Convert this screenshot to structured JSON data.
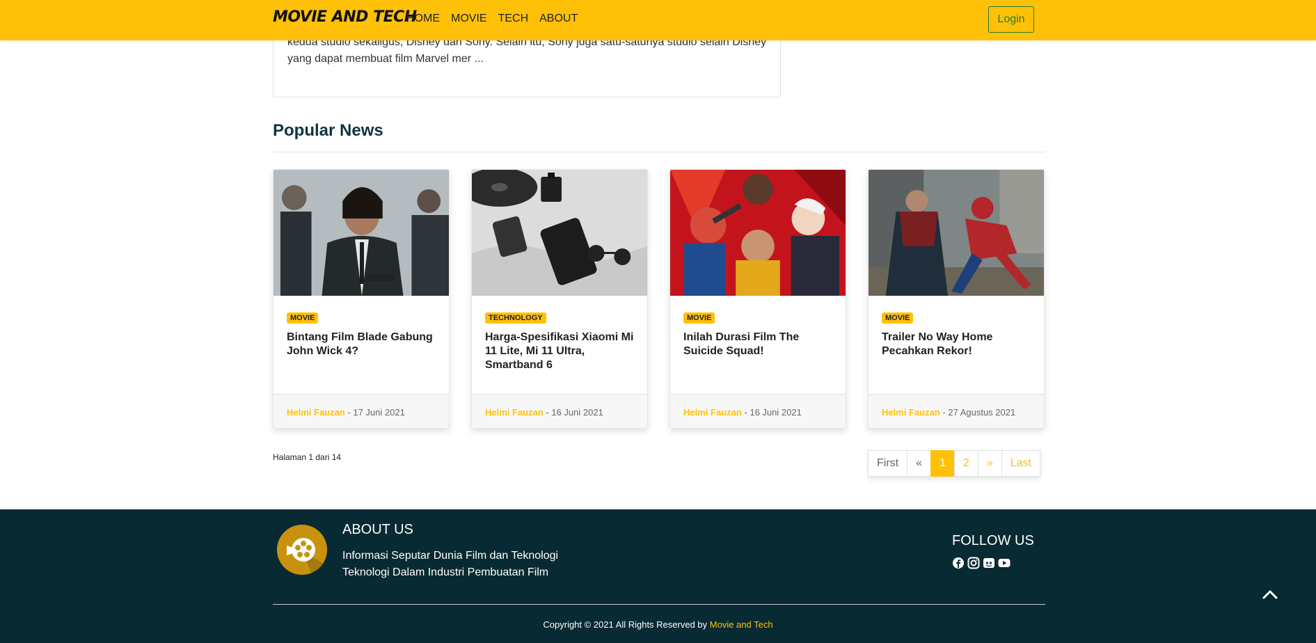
{
  "navbar": {
    "brand": "MOVIE AND TECH",
    "links": [
      "HOME",
      "MOVIE",
      "TECH",
      "ABOUT"
    ],
    "login_label": "Login",
    "bg_color": "#ffc107"
  },
  "previous_article": {
    "excerpt": "kedua studio sekaligus, Disney dan Sony. Selain itu, Sony juga satu-satunya studio selain Disney yang dapat membuat film Marvel mer ..."
  },
  "popular": {
    "heading": "Popular News",
    "cards": [
      {
        "image": "john-wick-photo",
        "category": "MOVIE",
        "title": "Bintang Film Blade Gabung John Wick 4?",
        "author": "Helmi Fauzan",
        "date": " - 17 Juni 2021"
      },
      {
        "image": "xiaomi-phone-photo",
        "category": "TECHNOLOGY",
        "title": "Harga-Spesifikasi Xiaomi Mi 11 Lite, Mi 11 Ultra, Smartband 6",
        "author": "Helmi Fauzan",
        "date": " - 16 Juni 2021"
      },
      {
        "image": "suicide-squad-photo",
        "category": "MOVIE",
        "title": "Inilah Durasi Film The Suicide Squad!",
        "author": "Helmi Fauzan",
        "date": " - 16 Juni 2021"
      },
      {
        "image": "spiderman-photo",
        "category": "MOVIE",
        "title": "Trailer No Way Home Pecahkan Rekor!",
        "author": "Helmi Fauzan",
        "date": " - 27 Agustus 2021"
      }
    ]
  },
  "pagination": {
    "info": "Halaman 1 dari 14",
    "first": "First",
    "prev": "«",
    "pages": [
      "1",
      "2"
    ],
    "next": "»",
    "last": "Last",
    "active_page": "1"
  },
  "footer": {
    "about_title": "ABOUT US",
    "about_line1": "Informasi Seputar Dunia Film dan Teknologi",
    "about_line2": "Teknologi Dalam Industri Pembuatan Film",
    "follow_title": "FOLLOW US",
    "socials": [
      "facebook-icon",
      "instagram-icon",
      "discord-icon",
      "youtube-icon"
    ],
    "copyright_prefix": "Copyright © 2021 All Rights Reserved by ",
    "copyright_brand": "Movie and Tech"
  }
}
